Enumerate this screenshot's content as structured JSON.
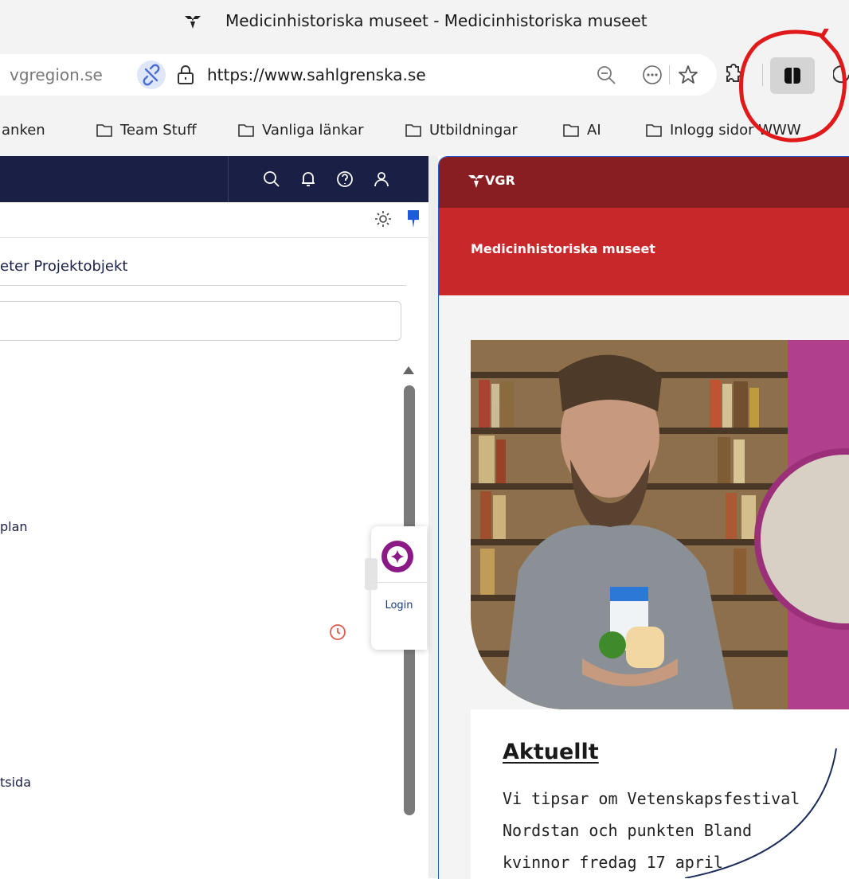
{
  "window": {
    "title": "Medicinhistoriska museet - Medicinhistoriska museet",
    "title_icon": "vgr-logo-icon"
  },
  "address_bar": {
    "left_domain": "vgregion.se",
    "url": "https://www.sahlgrenska.se",
    "icons": [
      "unlink-icon",
      "lock-icon",
      "zoom-out-icon",
      "more-icon",
      "star-icon",
      "extensions-icon",
      "split-screen-icon",
      "refresh-icon"
    ]
  },
  "bookmarks": [
    "anken",
    "Team Stuff",
    "Vanliga länkar",
    "Utbildningar",
    "AI",
    "Inlogg sidor WWW"
  ],
  "left_pane": {
    "top_icons": [
      "search-icon",
      "bell-icon",
      "help-icon",
      "user-icon"
    ],
    "tabs_text": "eter  Projektobjekt",
    "list_item_1": "plan",
    "list_item_2": "tsida"
  },
  "widget": {
    "login_label": "Login"
  },
  "right_pane": {
    "brand": "VGR",
    "site_name": "Medicinhistoriska museet",
    "heading": "Aktuellt",
    "paragraph_lines": [
      "Vi tipsar om Vetenskapsfestival",
      "Nordstan och punkten Bland",
      "kvinnor fredag 17 april"
    ]
  },
  "colors": {
    "vgr_dark": "#891e22",
    "vgr_red": "#c9282b",
    "left_header": "#1a1f45",
    "annotation": "#e0191b"
  }
}
